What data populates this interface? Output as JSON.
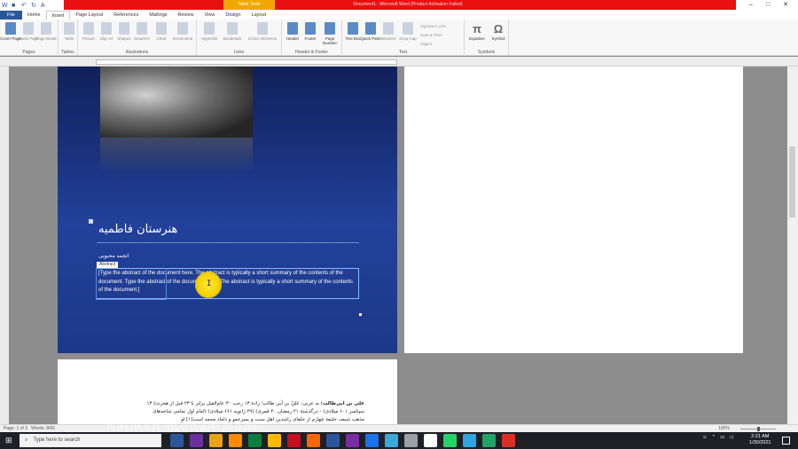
{
  "window": {
    "title": "Document1 - Microsoft Word (Product Activation Failed)",
    "context_tab": "Table Tools",
    "controls": [
      "–",
      "□",
      "✕"
    ]
  },
  "ribbon_tabs": [
    "File",
    "Home",
    "Insert",
    "Page Layout",
    "References",
    "Mailings",
    "Review",
    "View",
    "Design",
    "Layout"
  ],
  "active_tab": "Insert",
  "ribbon_groups": [
    {
      "label": "Pages",
      "buttons": [
        "Cover Page",
        "Blank Page",
        "Page Break"
      ]
    },
    {
      "label": "Tables",
      "buttons": [
        "Table"
      ]
    },
    {
      "label": "Illustrations",
      "buttons": [
        "Picture",
        "Clip Art",
        "Shapes",
        "SmartArt",
        "Chart",
        "Screenshot"
      ]
    },
    {
      "label": "Links",
      "buttons": [
        "Hyperlink",
        "Bookmark",
        "Cross-reference"
      ]
    },
    {
      "label": "Header & Footer",
      "buttons": [
        "Header",
        "Footer",
        "Page Number"
      ]
    },
    {
      "label": "Text",
      "buttons": [
        "Text Box",
        "Quick Parts",
        "WordArt",
        "Drop Cap"
      ],
      "side": [
        "Signature Line",
        "Date & Time",
        "Object"
      ]
    },
    {
      "label": "Symbols",
      "buttons": [
        "Equation",
        "Symbol"
      ]
    }
  ],
  "cover": {
    "title": "هنرستان فاطمیه",
    "author": "انجمه محبوبی",
    "abstract_label": "Abstract",
    "abstract_text": "[Type the abstract of the document here. The abstract is typically a short summary of the contents of the document. Type the abstract of the document here. The abstract is typically a short summary of the contents of the document.]"
  },
  "page3_text": {
    "bold": "علی بن ابی‌طالب",
    "line1": ") به عربی: عَلِيّ بن أبي طالب؛ زادهٔ ۱۳ رجب ۳۰ عام‌الفیل برابر با ۲۳ قبل از هجرت) ۱۳",
    "line2": "سپتامبر ۶۰۱ میلادی) – درگذشتهٔ ۲۱ رمضان ۴۰ قمری) (۲۹ ژانویه ۶۶۱ میلادی) (امام اول تمامی شاخه‌های",
    "line3": "مذهب شیعه، خلیفهٔ چهارم از خلفای راشدین اهل سنت و پسرعمو و داماد محمد است[۱] او"
  },
  "status": {
    "page": "Page: 1 of 3",
    "words": "Words: 8/66",
    "zoom": "100%"
  },
  "taskbar": {
    "search_placeholder": "Type here to search",
    "time": "2:21 AM",
    "date": "1/30/2021",
    "app_colors": [
      "#2b579a",
      "#6b2fa0",
      "#e8a317",
      "#ff8a00",
      "#0a7f3f",
      "#ffb900",
      "#c50e1f",
      "#ff6600",
      "#2b579a",
      "#7a2ca3",
      "#1a73e8",
      "#3aa8d9",
      "#9aa0a6",
      "#ffffff",
      "#25d366",
      "#2ca5e0",
      "#21a366",
      "#d93025"
    ]
  },
  "watermark": "hajmeh mohammadi"
}
